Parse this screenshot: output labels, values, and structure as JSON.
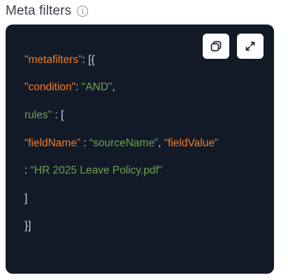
{
  "header": {
    "title": "Meta filters",
    "info_icon": "info-icon"
  },
  "code": {
    "line1_key": "\"metafilters\"",
    "line1_rest": ": [{",
    "line2_key": "\"condition\"",
    "line2_colon": ": ",
    "line2_value": "\"AND\"",
    "line2_comma": ",",
    "line3_key": "rules\"",
    "line3_rest": " : [",
    "line4_key": "“fieldName”",
    "line4_colon": " : ",
    "line4_value": "“sourceName”",
    "line4_comma": ", ",
    "line4_key2": "“fieldValue”",
    "line5_colon": ": ",
    "line5_value": "“HR 2025 Leave Policy.pdf”",
    "line6": "]",
    "line7": "}]"
  },
  "buttons": {
    "copy_icon": "copy-icon",
    "expand_icon": "expand-icon"
  },
  "colors": {
    "card_bg": "#121a28",
    "key": "#f27e2a",
    "string": "#6ea24f",
    "punctuation": "#d3d6dc"
  }
}
